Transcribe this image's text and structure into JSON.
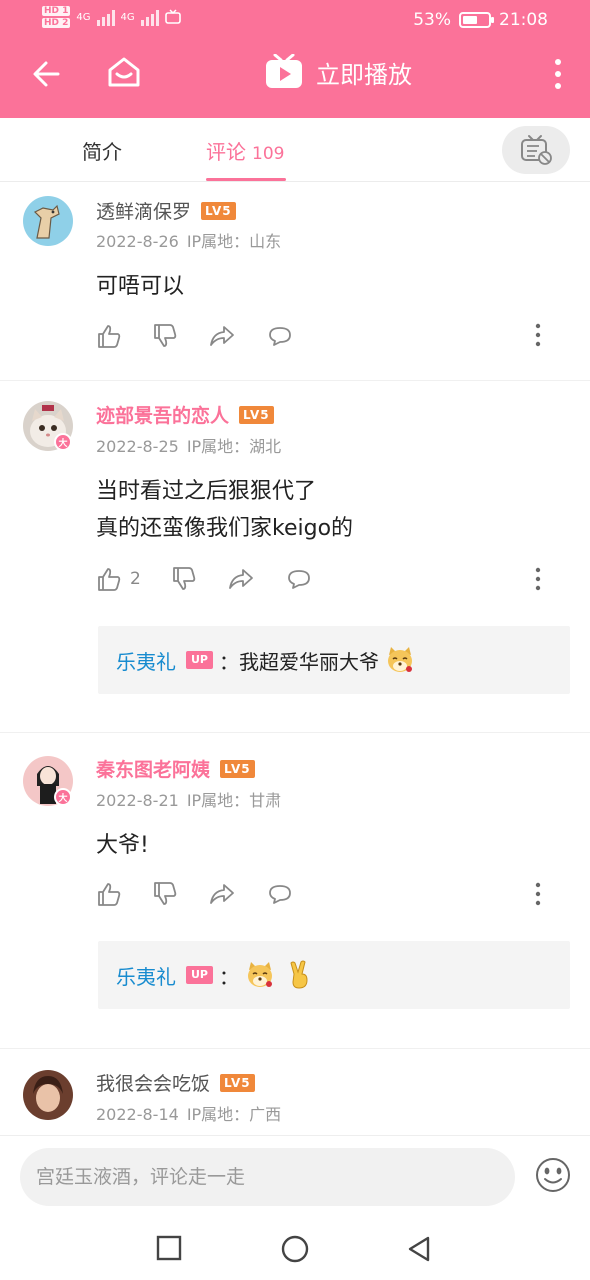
{
  "status_bar": {
    "sim1": "HD 1",
    "sim2": "HD 2",
    "net1": "4G",
    "net2": "4G",
    "battery_pct": "53%",
    "time": "21:08"
  },
  "app_bar": {
    "play_label": "立即播放",
    "color": "#fb7299"
  },
  "tabs": {
    "intro": "简介",
    "comments": "评论",
    "comments_count": "109",
    "danmaku_icon": "danmaku-off-icon"
  },
  "comments": [
    {
      "user": "透鲜滴保罗",
      "level": "LV5",
      "vip": false,
      "date": "2022-8-26",
      "ip": "IP属地：山东",
      "content": [
        "可唔可以"
      ],
      "likes": ""
    },
    {
      "user": "迹部景吾的恋人",
      "level": "LV5",
      "vip": true,
      "badge": "大",
      "date": "2022-8-25",
      "ip": "IP属地：湖北",
      "content": [
        "当时看过之后狠狠代了",
        "真的还蛮像我们家keigo的"
      ],
      "likes": "2",
      "reply": {
        "user": "乐夷礼",
        "tag": "UP",
        "text": "：我超爱华丽大爷"
      }
    },
    {
      "user": "秦东图老阿姨",
      "level": "LV5",
      "vip": true,
      "badge": "大",
      "date": "2022-8-21",
      "ip": "IP属地：甘肃",
      "content": [
        "大爷!"
      ],
      "likes": "",
      "reply": {
        "user": "乐夷礼",
        "tag": "UP",
        "text": "："
      }
    },
    {
      "user": "我很会会吃饭",
      "level": "LV5",
      "vip": false,
      "date": "2022-8-14",
      "ip": "IP属地：广西",
      "content": [],
      "likes": ""
    }
  ],
  "input": {
    "placeholder": "宫廷玉液酒，评论走一走"
  }
}
